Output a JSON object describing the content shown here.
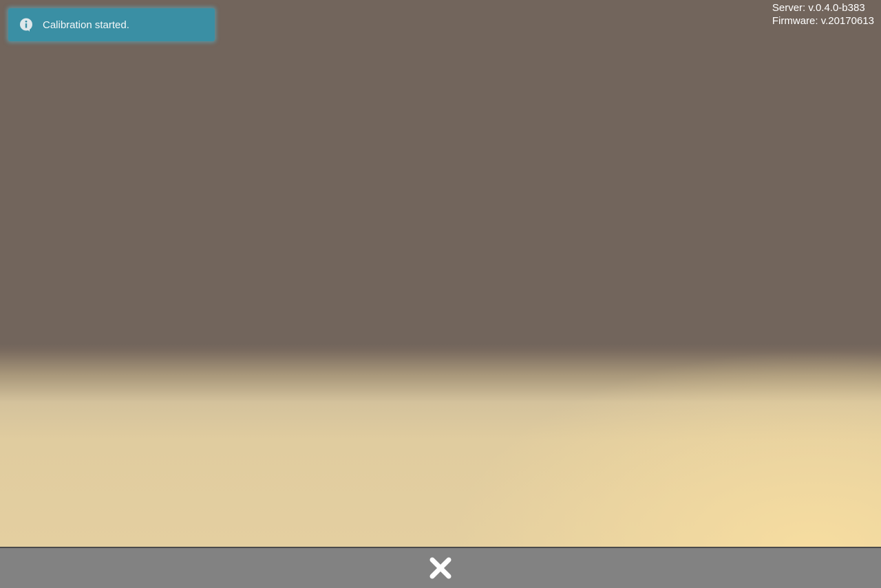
{
  "notification": {
    "icon": "info-icon",
    "message": "Calibration started."
  },
  "version_info": {
    "server": "Server: v.0.4.0-b383",
    "firmware": "Firmware: v.20170613"
  },
  "bottom_bar": {
    "close_icon": "close-icon"
  },
  "colors": {
    "notification_bg": "#3a8fa4",
    "bottom_bar_bg": "#828282",
    "background_top": "#72655c",
    "background_bottom": "#e4cfa0"
  }
}
